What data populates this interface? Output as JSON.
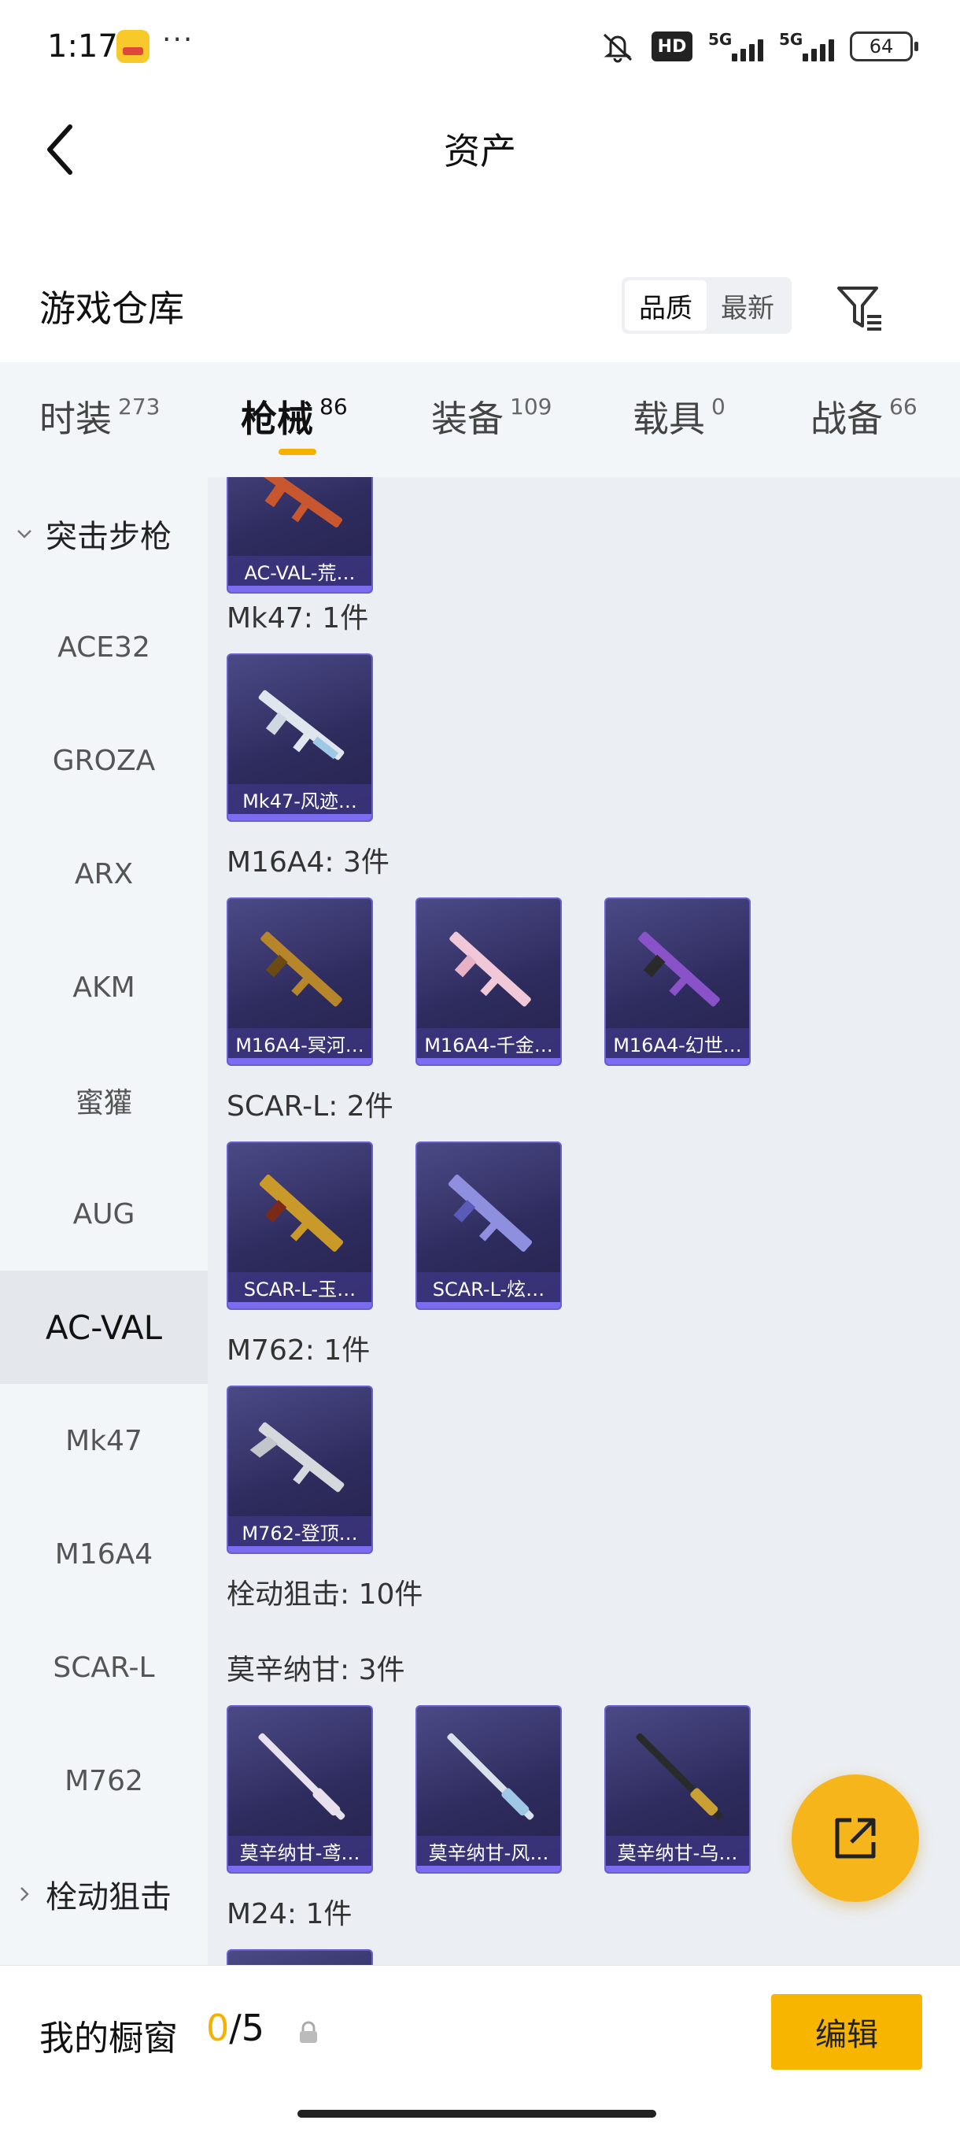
{
  "status_bar": {
    "time": "1:17",
    "dots": "···",
    "hd_label": "HD",
    "signal1_label": "5G",
    "signal2_label": "5G",
    "battery": "64"
  },
  "nav": {
    "title": "资产"
  },
  "warehouse": {
    "title": "游戏仓库",
    "sort_options": [
      "品质",
      "最新"
    ],
    "sort_selected": "品质"
  },
  "tabs": [
    {
      "label": "时装",
      "count": "273"
    },
    {
      "label": "枪械",
      "count": "86",
      "active": true
    },
    {
      "label": "装备",
      "count": "109"
    },
    {
      "label": "载具",
      "count": "0"
    },
    {
      "label": "战备",
      "count": "66"
    }
  ],
  "sidebar": {
    "items": [
      {
        "label": "突击步枪",
        "type": "group-expanded"
      },
      {
        "label": "ACE32"
      },
      {
        "label": "GROZA"
      },
      {
        "label": "ARX"
      },
      {
        "label": "AKM"
      },
      {
        "label": "蜜獾"
      },
      {
        "label": "AUG"
      },
      {
        "label": "AC-VAL",
        "active": true
      },
      {
        "label": "Mk47"
      },
      {
        "label": "M16A4"
      },
      {
        "label": "SCAR-L"
      },
      {
        "label": "M762"
      },
      {
        "label": "栓动狙击",
        "type": "group-collapsed"
      }
    ]
  },
  "content": {
    "groups": [
      {
        "label": "",
        "items": [
          {
            "name": "AC-VAL-荒…",
            "color": "#c8562e"
          }
        ]
      },
      {
        "label": "Mk47: 1件",
        "items": [
          {
            "name": "Mk47-风迹…",
            "color": "#dfe6ee"
          }
        ]
      },
      {
        "label": "M16A4: 3件",
        "items": [
          {
            "name": "M16A4-冥河…",
            "color": "#b8862a"
          },
          {
            "name": "M16A4-千金…",
            "color": "#f0c8d8"
          },
          {
            "name": "M16A4-幻世…",
            "color": "#8a52c8"
          }
        ]
      },
      {
        "label": "SCAR-L: 2件",
        "items": [
          {
            "name": "SCAR-L-玉…",
            "color": "#c99a2a"
          },
          {
            "name": "SCAR-L-炫…",
            "color": "#8f8fe0"
          }
        ]
      },
      {
        "label": "M762: 1件",
        "items": [
          {
            "name": "M762-登顶…",
            "color": "#d5d8dc"
          }
        ]
      },
      {
        "label": "栓动狙击: 10件",
        "items": []
      },
      {
        "label": "莫辛纳甘: 3件",
        "items": [
          {
            "name": "莫辛纳甘-鸢…",
            "color": "#e8e0ec"
          },
          {
            "name": "莫辛纳甘-风…",
            "color": "#d8e2ea"
          },
          {
            "name": "莫辛纳甘-乌…",
            "color": "#c9a031"
          }
        ]
      },
      {
        "label": "M24: 1件",
        "items": []
      }
    ]
  },
  "bottom": {
    "showcase_label": "我的橱窗",
    "showcase_current": "0",
    "showcase_total": "/5",
    "edit_label": "编辑"
  },
  "colors": {
    "accent": "#f7b500",
    "card_bg": "#2e2c5e",
    "card_border": "#6a5fd0"
  }
}
